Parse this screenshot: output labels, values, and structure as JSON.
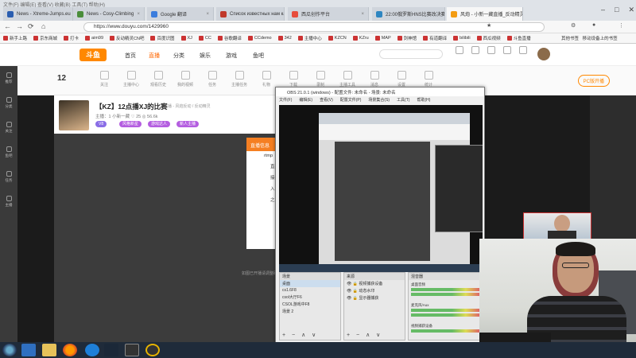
{
  "browser": {
    "window_menu": "文件(F)  编辑(E)  查看(V)  收藏(B)  工具(T)  帮助(H)",
    "tabs": [
      {
        "label": "News - Xtreme-Jumps.eu",
        "color": "#2a5db0",
        "active": false
      },
      {
        "label": "News - Cosy-Climbing",
        "color": "#4a8d3a",
        "active": false
      },
      {
        "label": "Google 翻译",
        "color": "#3b7ddd",
        "active": false
      },
      {
        "label": "Список известных нам карт",
        "color": "#c0392b",
        "active": false
      },
      {
        "label": "西瓜创作平台",
        "color": "#e74c3c",
        "active": false
      },
      {
        "label": "22:00俄罗斯HNS比赛改决赛",
        "color": "#2e86c1",
        "active": false
      },
      {
        "label": "风炮 - 小新一藏直播_反动精灵",
        "color": "#f39c12",
        "active": true
      }
    ],
    "url": "https://www.douyu.com/1429960",
    "bookmarks": [
      "新手上路",
      "京东商城",
      "打卡",
      "aim99",
      "反动精灵CN吧",
      "百度识图",
      "XJ",
      "CC",
      "谷歌翻译",
      "CCdemo",
      "342",
      "主播中心",
      "KZCN",
      "KZru",
      "MAP",
      "剑神馆",
      "有道翻译",
      "bilibili",
      "西瓜视频",
      "斗鱼直播"
    ],
    "right_bookmarks": [
      "其他书签",
      "移动设备上的书签"
    ]
  },
  "douyu": {
    "logo": "斗鱼",
    "nav": [
      "首页",
      "直播",
      "分类",
      "娱乐",
      "游戏",
      "鱼吧"
    ],
    "active_nav": "直播",
    "toolbar_items": [
      "12",
      "关注",
      "主播中心",
      "观看历史",
      "我的视频",
      "任务",
      "主播任务",
      "礼物",
      "下载",
      "录制",
      "主播工具",
      "消息",
      "设置",
      "统计"
    ],
    "pc_live": "PC版开播",
    "room_title": "【KZ】12点播XJ的比赛",
    "room_category": "主播 - 风炮反动 / 反动精灵",
    "room_meta": "主播：1 小新一藏  ♡ 25  ◎ 56.6k",
    "room_tags": [
      "V8",
      "风格新星",
      "游戏达人",
      "新人主播"
    ],
    "dialog_title": "直播信息",
    "dialog_lines": [
      "rtmp",
      "直",
      "接",
      "入",
      "之"
    ],
    "video_footer": "如图已开播请调整码率"
  },
  "sidebar": [
    "推荐",
    "分类",
    "关注",
    "鱼吧",
    "任务",
    "主播"
  ],
  "obs": {
    "title": "OBS 21.0.1 (windows) - 配置文件: 未命名 - 场景: 未命名",
    "menu": [
      "文件(F)",
      "编辑(E)",
      "查看(V)",
      "配置文件(P)",
      "场景集合(S)",
      "工具(T)",
      "帮助(H)"
    ],
    "scenes_header": "场景",
    "scenes": [
      "桌面",
      "cs1.6F8",
      "csol大厅F6",
      "CSOL游戏中F8",
      "场景 2"
    ],
    "sources_header": "来源",
    "sources": [
      "视频捕获设备",
      "动态水印",
      "显示器捕获"
    ],
    "mixer_header": "混音器",
    "mixer_labels": [
      "桌面音频",
      "麦克风/Aux",
      "视频捕获设备"
    ],
    "controls": "+ − ∧ ∨"
  },
  "taskbar_apps": [
    "start",
    "ie",
    "explorer",
    "firefox",
    "k-app",
    "steam",
    "obs",
    "obs2"
  ]
}
